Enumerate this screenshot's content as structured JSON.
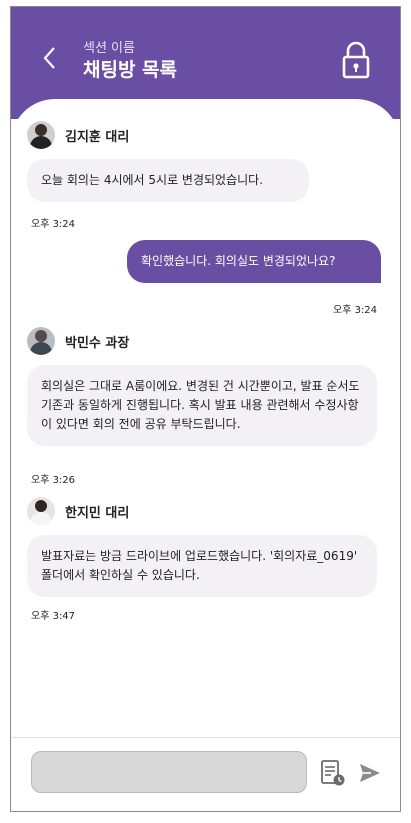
{
  "header": {
    "subtitle": "섹션 이름",
    "title": "채팅방 목록"
  },
  "messages": [
    {
      "type": "in",
      "sender": "김지훈 대리",
      "text": "오늘 회의는 4시에서 5시로 변경되었습니다.",
      "time": "오후 3:24"
    },
    {
      "type": "out",
      "text": "확인했습니다. 회의실도 변경되었나요?",
      "time": "오후 3:24"
    },
    {
      "type": "in",
      "sender": "박민수 과장",
      "text": "회의실은 그대로 A룸이에요. 변경된 건 시간뿐이고, 발표 순서도 기존과 동일하게 진행됩니다. 혹시 발표 내용 관련해서 수정사항이 있다면 회의 전에 공유 부탁드립니다.",
      "time": "오후 3:26"
    },
    {
      "type": "in",
      "sender": "한지민 대리",
      "text": "발표자료는 방금 드라이브에 업로드했습니다. '회의자료_0619' 폴더에서 확인하실 수 있습니다.",
      "time": "오후 3:47"
    }
  ],
  "composer": {
    "placeholder": "",
    "attach_icon": "document-clock-icon",
    "send_icon": "send-icon"
  },
  "colors": {
    "primary": "#6a4ea3",
    "bubble_in": "#f3f1f6",
    "input_bg": "#d8d8d8"
  }
}
